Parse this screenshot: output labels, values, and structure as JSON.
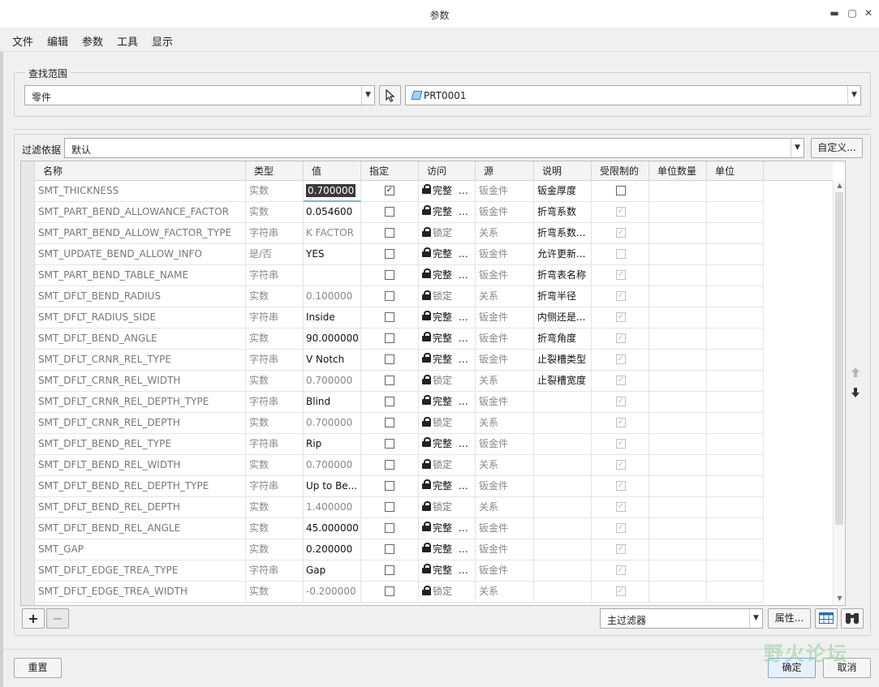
{
  "window": {
    "title": "参数",
    "controls": {
      "minimize": "▬",
      "maximize": "▢",
      "close": "✕"
    }
  },
  "menu": [
    "文件",
    "编辑",
    "参数",
    "工具",
    "显示"
  ],
  "lookin": {
    "legend": "查找范围",
    "scope_value": "零件",
    "object_value": "PRT0001"
  },
  "filter": {
    "label": "过滤依据",
    "value": "默认",
    "customize_label": "自定义..."
  },
  "columns": [
    "名称",
    "类型",
    "值",
    "指定",
    "访问",
    "源",
    "说明",
    "受限制的",
    "单位数量",
    "单位"
  ],
  "rows": [
    {
      "name": "SMT_THICKNESS",
      "type": "实数",
      "value": "0.700000",
      "value_state": "selected",
      "designate": true,
      "access": "完整",
      "access_locked": false,
      "source": "钣金件",
      "desc": "钣金厚度",
      "restricted": "enabled-unchecked"
    },
    {
      "name": "SMT_PART_BEND_ALLOWANCE_FACTOR",
      "type": "实数",
      "value": "0.054600",
      "value_state": "normal",
      "designate": false,
      "access": "完整",
      "access_locked": false,
      "source": "钣金件",
      "desc": "折弯系数",
      "restricted": "disabled-checked"
    },
    {
      "name": "SMT_PART_BEND_ALLOW_FACTOR_TYPE",
      "type": "字符串",
      "value": "K FACTOR",
      "value_state": "grey",
      "designate": false,
      "access": "锁定",
      "access_locked": true,
      "source": "关系",
      "desc": "折弯系数...",
      "restricted": "disabled-checked"
    },
    {
      "name": "SMT_UPDATE_BEND_ALLOW_INFO",
      "type": "是/否",
      "value": "YES",
      "value_state": "normal",
      "designate": false,
      "access": "完整",
      "access_locked": false,
      "source": "钣金件",
      "desc": "允许更新...",
      "restricted": "disabled-unchecked"
    },
    {
      "name": "SMT_PART_BEND_TABLE_NAME",
      "type": "字符串",
      "value": "",
      "value_state": "normal",
      "designate": false,
      "access": "完整",
      "access_locked": false,
      "source": "钣金件",
      "desc": "折弯表名称",
      "restricted": "disabled-checked"
    },
    {
      "name": "SMT_DFLT_BEND_RADIUS",
      "type": "实数",
      "value": "0.100000",
      "value_state": "grey",
      "designate": false,
      "access": "锁定",
      "access_locked": true,
      "source": "关系",
      "desc": "折弯半径",
      "restricted": "disabled-checked"
    },
    {
      "name": "SMT_DFLT_RADIUS_SIDE",
      "type": "字符串",
      "value": "Inside",
      "value_state": "normal",
      "designate": false,
      "access": "完整",
      "access_locked": false,
      "source": "钣金件",
      "desc": "内侧还是...",
      "restricted": "disabled-checked"
    },
    {
      "name": "SMT_DFLT_BEND_ANGLE",
      "type": "实数",
      "value": "90.000000",
      "value_state": "normal",
      "designate": false,
      "access": "完整",
      "access_locked": false,
      "source": "钣金件",
      "desc": "折弯角度",
      "restricted": "disabled-checked"
    },
    {
      "name": "SMT_DFLT_CRNR_REL_TYPE",
      "type": "字符串",
      "value": "V Notch",
      "value_state": "normal",
      "designate": false,
      "access": "完整",
      "access_locked": false,
      "source": "钣金件",
      "desc": "止裂槽类型",
      "restricted": "disabled-checked"
    },
    {
      "name": "SMT_DFLT_CRNR_REL_WIDTH",
      "type": "实数",
      "value": "0.700000",
      "value_state": "grey",
      "designate": false,
      "access": "锁定",
      "access_locked": true,
      "source": "关系",
      "desc": "止裂槽宽度",
      "restricted": "disabled-checked"
    },
    {
      "name": "SMT_DFLT_CRNR_REL_DEPTH_TYPE",
      "type": "字符串",
      "value": "Blind",
      "value_state": "normal",
      "designate": false,
      "access": "完整",
      "access_locked": false,
      "source": "钣金件",
      "desc": "",
      "restricted": "disabled-checked"
    },
    {
      "name": "SMT_DFLT_CRNR_REL_DEPTH",
      "type": "实数",
      "value": "0.700000",
      "value_state": "grey",
      "designate": false,
      "access": "锁定",
      "access_locked": true,
      "source": "关系",
      "desc": "",
      "restricted": "disabled-checked"
    },
    {
      "name": "SMT_DFLT_BEND_REL_TYPE",
      "type": "字符串",
      "value": "Rip",
      "value_state": "normal",
      "designate": false,
      "access": "完整",
      "access_locked": false,
      "source": "钣金件",
      "desc": "",
      "restricted": "disabled-checked"
    },
    {
      "name": "SMT_DFLT_BEND_REL_WIDTH",
      "type": "实数",
      "value": "0.700000",
      "value_state": "grey",
      "designate": false,
      "access": "锁定",
      "access_locked": true,
      "source": "关系",
      "desc": "",
      "restricted": "disabled-checked"
    },
    {
      "name": "SMT_DFLT_BEND_REL_DEPTH_TYPE",
      "type": "字符串",
      "value": "Up to Be...",
      "value_state": "normal",
      "designate": false,
      "access": "完整",
      "access_locked": false,
      "source": "钣金件",
      "desc": "",
      "restricted": "disabled-checked"
    },
    {
      "name": "SMT_DFLT_BEND_REL_DEPTH",
      "type": "实数",
      "value": "1.400000",
      "value_state": "grey",
      "designate": false,
      "access": "锁定",
      "access_locked": true,
      "source": "关系",
      "desc": "",
      "restricted": "disabled-checked"
    },
    {
      "name": "SMT_DFLT_BEND_REL_ANGLE",
      "type": "实数",
      "value": "45.000000",
      "value_state": "normal",
      "designate": false,
      "access": "完整",
      "access_locked": false,
      "source": "钣金件",
      "desc": "",
      "restricted": "disabled-checked"
    },
    {
      "name": "SMT_GAP",
      "type": "实数",
      "value": "0.200000",
      "value_state": "normal",
      "designate": false,
      "access": "完整",
      "access_locked": false,
      "source": "钣金件",
      "desc": "",
      "restricted": "disabled-checked"
    },
    {
      "name": "SMT_DFLT_EDGE_TREA_TYPE",
      "type": "字符串",
      "value": "Gap",
      "value_state": "normal",
      "designate": false,
      "access": "完整",
      "access_locked": false,
      "source": "钣金件",
      "desc": "",
      "restricted": "disabled-checked"
    },
    {
      "name": "SMT_DFLT_EDGE_TREA_WIDTH",
      "type": "实数",
      "value": "-0.200000",
      "value_state": "grey",
      "designate": false,
      "access": "锁定",
      "access_locked": true,
      "source": "关系",
      "desc": "",
      "restricted": "disabled-checked"
    }
  ],
  "bottom_toolbar": {
    "add": "+",
    "remove": "−",
    "filter_combo": "主过滤器",
    "properties_label": "属性..."
  },
  "footer": {
    "reset": "重置",
    "ok": "确定",
    "cancel": "取消"
  },
  "watermark": "野火论坛",
  "icons": {
    "select": "pointer-cursor-icon",
    "part": "part-icon",
    "table_view": "table-grid-icon",
    "find": "binoculars-icon",
    "move_up": "arrow-up-icon",
    "move_down": "arrow-down-icon"
  }
}
